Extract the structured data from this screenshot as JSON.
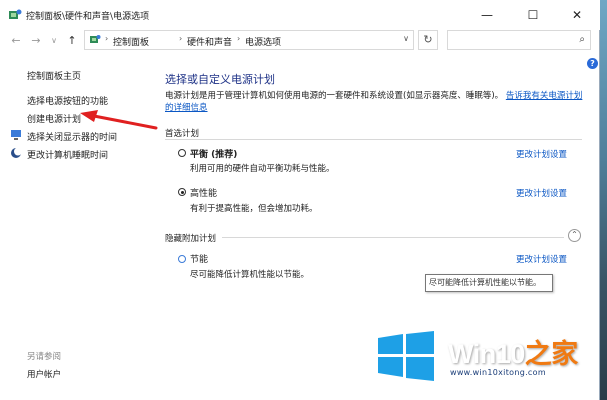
{
  "window": {
    "title": "控制面板\\硬件和声音\\电源选项",
    "minimize": "—",
    "maximize": "☐",
    "close": "✕"
  },
  "nav": {
    "back": "←",
    "forward": "→",
    "recent": "∨",
    "up": "↑"
  },
  "address": {
    "crumbs": [
      "控制面板",
      "硬件和声音",
      "电源选项"
    ],
    "separator": "›",
    "dropdown": "∨",
    "refresh": "↻",
    "search_placeholder": ""
  },
  "help": "?",
  "sidebar": {
    "home": "控制面板主页",
    "items": [
      {
        "label": "选择电源按钮的功能"
      },
      {
        "label": "创建电源计划"
      },
      {
        "label": "选择关闭显示器的时间"
      },
      {
        "label": "更改计算机睡眠时间"
      }
    ],
    "see_also": "另请参阅",
    "user_accounts": "用户帐户"
  },
  "main": {
    "title": "选择或自定义电源计划",
    "desc_text": "电源计划是用于管理计算机如何使用电源的一套硬件和系统设置(如显示器亮度、睡眠等)。",
    "desc_link": "告诉我有关电源计划的详细信息",
    "preferred_header": "首选计划",
    "hidden_header": "隐藏附加计划",
    "plans": [
      {
        "name": "平衡 (推荐)",
        "desc": "利用可用的硬件自动平衡功耗与性能。",
        "link": "更改计划设置",
        "selected": false
      },
      {
        "name": "高性能",
        "desc": "有利于提高性能，但会增加功耗。",
        "link": "更改计划设置",
        "selected": true
      },
      {
        "name": "节能",
        "desc": "尽可能降低计算机性能以节能。",
        "link": "更改计划设置",
        "selected": false
      }
    ],
    "collapse": "⌃",
    "tooltip": "尽可能降低计算机性能以节能。"
  },
  "watermark": {
    "brand_a": "Win10",
    "brand_b": "之家",
    "url": "www.win10xitong.com"
  },
  "colors": {
    "title_blue": "#1e3287",
    "link_blue": "#0b57c4",
    "arrow_red": "#e02020",
    "logo_blue": "#1ea0e6",
    "brand_orange": "#f07a12"
  }
}
